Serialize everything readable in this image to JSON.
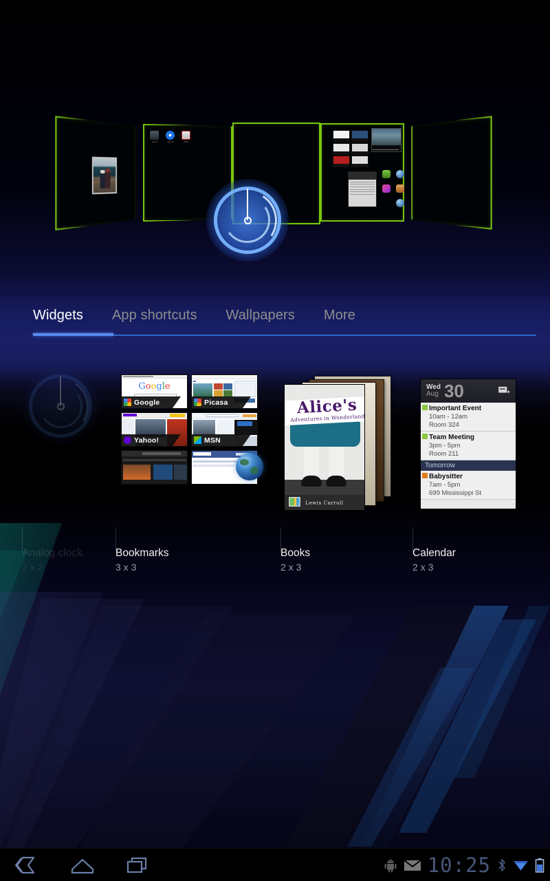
{
  "app": {
    "name": "Android Launcher",
    "screen": "widget-picker"
  },
  "tabs": [
    {
      "label": "Widgets",
      "active": true,
      "name": "tab-widgets"
    },
    {
      "label": "App shortcuts",
      "active": false,
      "name": "tab-app-shortcuts"
    },
    {
      "label": "Wallpapers",
      "active": false,
      "name": "tab-wallpapers"
    },
    {
      "label": "More",
      "active": false,
      "name": "tab-more"
    }
  ],
  "homescreen_previews": [
    {
      "index": 1,
      "contents": "photo-frame-widget"
    },
    {
      "index": 2,
      "contents": "three-app-shortcuts"
    },
    {
      "index": 3,
      "contents": "empty-drop-target"
    },
    {
      "index": 4,
      "contents": "bookmarks-news-calendar-apps"
    },
    {
      "index": 5,
      "contents": "empty"
    }
  ],
  "preview_apps": [
    {
      "label": "Email",
      "color": "#3d4a52"
    },
    {
      "label": "Chrome",
      "color": "#1a73e8"
    },
    {
      "label": "Music",
      "color": "#c5272d"
    }
  ],
  "drag_item": {
    "name": "analog-clock-drag-preview"
  },
  "widgets": [
    {
      "name": "Analog clock",
      "size": "2 x 2",
      "faded": true,
      "kind": "analog-clock"
    },
    {
      "name": "Bookmarks",
      "size": "3 x 3",
      "faded": false,
      "kind": "bookmarks",
      "bookmarks": [
        {
          "title": "Google",
          "favicon": "google-favicon"
        },
        {
          "title": "Picasa",
          "favicon": "picasa-favicon"
        },
        {
          "title": "Yahoo!",
          "favicon": "yahoo-favicon"
        },
        {
          "title": "MSN",
          "favicon": "msn-favicon"
        },
        {
          "title": "",
          "favicon": ""
        },
        {
          "title": "",
          "favicon": ""
        }
      ]
    },
    {
      "name": "Books",
      "size": "2 x 3",
      "faded": false,
      "kind": "books",
      "book": {
        "title": "Alice's",
        "subtitle": "Adventures in Wonderland",
        "author": "Lewis Carroll"
      }
    },
    {
      "name": "Calendar",
      "size": "2 x 3",
      "faded": false,
      "kind": "calendar",
      "calendar": {
        "day_of_week": "Wed",
        "month": "Aug",
        "day": "30",
        "add_icon": "add-event-icon",
        "events": [
          {
            "title": "Important Event",
            "time": "10am - 12am",
            "place": "Room 324",
            "color": "#8cc63f"
          },
          {
            "title": "Team Meeting",
            "time": "3pm - 5pm",
            "place": "Room 211",
            "color": "#8cc63f"
          }
        ],
        "separator": "Tomorrow",
        "events_tomorrow": [
          {
            "title": "Babysitter",
            "time": "7am - 5pm",
            "place": "699 Mississippi St",
            "color": "#e07b1a"
          }
        ]
      }
    }
  ],
  "system_bar": {
    "nav": [
      {
        "label": "Back",
        "icon": "back-icon"
      },
      {
        "label": "Home",
        "icon": "home-icon"
      },
      {
        "label": "Recent apps",
        "icon": "recent-apps-icon"
      }
    ],
    "notifications": [
      {
        "icon": "android-bug-icon"
      },
      {
        "icon": "email-icon"
      }
    ],
    "time": "10:25",
    "status": [
      {
        "icon": "bluetooth-icon"
      },
      {
        "icon": "wifi-icon"
      },
      {
        "icon": "battery-icon"
      }
    ]
  },
  "colors": {
    "preview_border": "#7ac60f",
    "tab_active_underline": "#5a8cf0",
    "tab_track": "#2f63c7",
    "status_blue": "#46577a",
    "calendar_green": "#8cc63f",
    "calendar_orange": "#e07b1a"
  }
}
